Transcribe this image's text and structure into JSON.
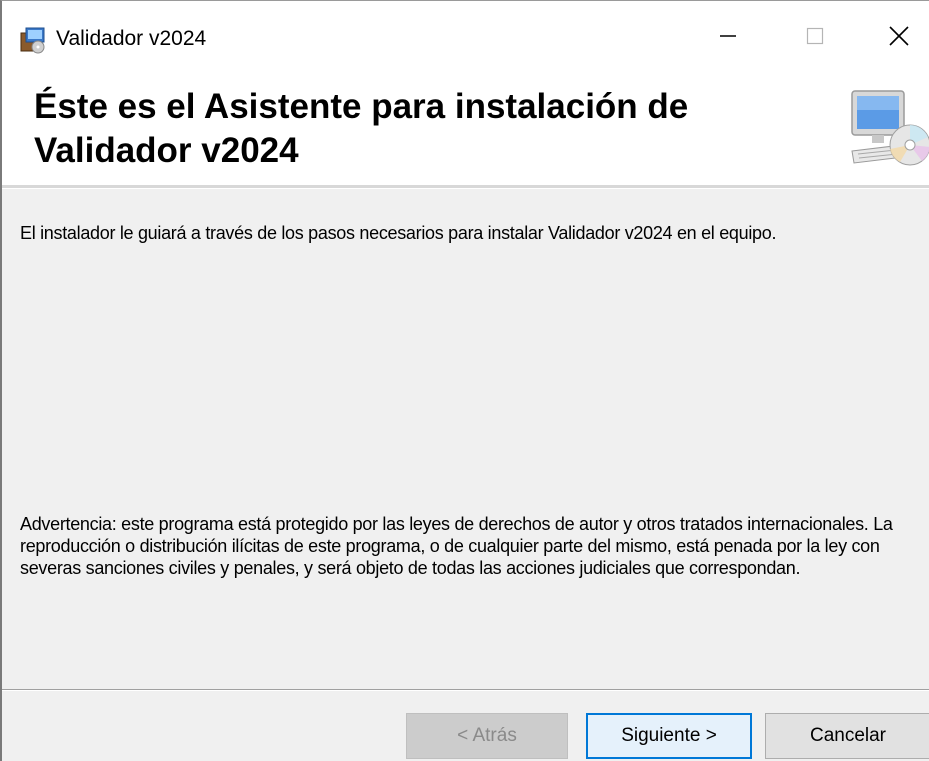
{
  "window": {
    "title": "Validador v2024",
    "controls": {
      "minimize_icon": "minimize-icon",
      "maximize_icon": "maximize-icon",
      "close_icon": "close-icon"
    }
  },
  "header": {
    "title": "Éste es el Asistente para instalación de Validador v2024",
    "icon": "computer-cd-icon"
  },
  "body": {
    "intro": "El instalador le guiará a través de los pasos necesarios para instalar Validador v2024 en el equipo.",
    "warning": "Advertencia: este programa está protegido por las leyes de derechos de autor y otros tratados internacionales. La reproducción o distribución ilícitas de este programa, o de cualquier parte del mismo, está penada por la ley con severas sanciones civiles y penales, y será objeto de todas las acciones judiciales que correspondan."
  },
  "buttons": {
    "back": "< Atrás",
    "next": "Siguiente >",
    "cancel": "Cancelar"
  },
  "colors": {
    "accent": "#0078d7",
    "background": "#f0f0f0",
    "banner": "#ffffff"
  }
}
